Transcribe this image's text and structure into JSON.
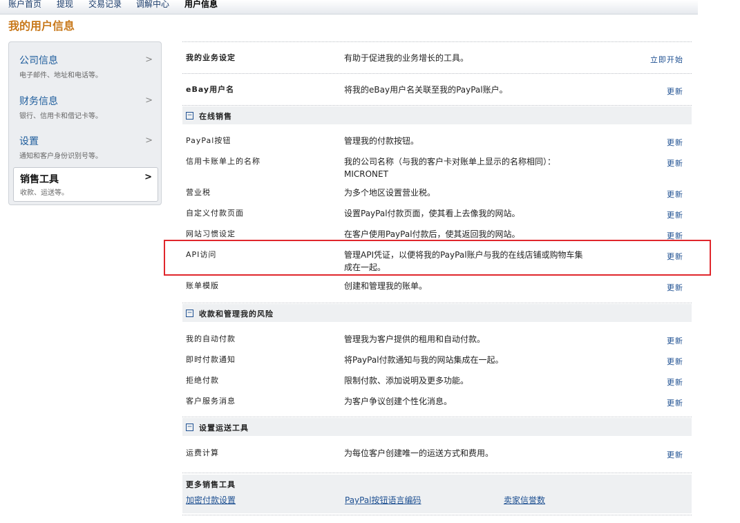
{
  "topnav": {
    "items": [
      "账户首页",
      "提现",
      "交易记录",
      "调解中心",
      "用户信息"
    ]
  },
  "page": {
    "title": "我的用户信息"
  },
  "sidebar": {
    "items": [
      {
        "label": "公司信息",
        "sub": "电子邮件、地址和电话等。",
        "chevron": ">"
      },
      {
        "label": "财务信息",
        "sub": "银行、信用卡和借记卡等。",
        "chevron": ">"
      },
      {
        "label": "设置",
        "sub": "通知和客户身份识别号等。",
        "chevron": ">"
      },
      {
        "label": "销售工具",
        "sub": "收款、运送等。",
        "chevron": ">"
      }
    ]
  },
  "main": {
    "business": {
      "name": "我的业务设定",
      "desc": "有助于促进我的业务增长的工具。",
      "action": "立即开始"
    },
    "ebay": {
      "name": "eBay用户名",
      "desc": "将我的eBay用户名关联至我的PayPal账户。",
      "action": "更新"
    },
    "sections": [
      {
        "toggle": "−",
        "title": "在线销售",
        "rows": [
          {
            "name": "PayPal按钮",
            "desc": "管理我的付款按钮。",
            "action": "更新"
          },
          {
            "name": "信用卡账单上的名称",
            "desc": "我的公司名称（与我的客户卡对账单上显示的名称相同）：MICRONET",
            "action": "更新"
          },
          {
            "name": "营业税",
            "desc": "为多个地区设置营业税。",
            "action": "更新"
          },
          {
            "name": "自定义付款页面",
            "desc": "设置PayPal付款页面，使其看上去像我的网站。",
            "action": "更新"
          },
          {
            "name": "网站习惯设定",
            "desc": "在客户使用PayPal付款后，使其返回我的网站。",
            "action": "更新"
          },
          {
            "name": "API访问",
            "desc": "管理API凭证，以便将我的PayPal账户与我的在线店铺或购物车集成在一起。",
            "action": "更新"
          },
          {
            "name": "账单模版",
            "desc": "创建和管理我的账单。",
            "action": "更新"
          }
        ]
      },
      {
        "toggle": "−",
        "title": "收款和管理我的风险",
        "rows": [
          {
            "name": "我的自动付款",
            "desc": "管理我为客户提供的租用和自动付款。",
            "action": "更新"
          },
          {
            "name": "即时付款通知",
            "desc": "将PayPal付款通知与我的网站集成在一起。",
            "action": "更新"
          },
          {
            "name": "拒绝付款",
            "desc": "限制付款、添加说明及更多功能。",
            "action": "更新"
          },
          {
            "name": "客户服务消息",
            "desc": "为客户争议创建个性化消息。",
            "action": "更新"
          }
        ]
      },
      {
        "toggle": "−",
        "title": "设置运送工具",
        "rows": [
          {
            "name": "运费计算",
            "desc": "为每位客户创建唯一的运送方式和费用。",
            "action": "更新"
          }
        ]
      }
    ],
    "more": {
      "title": "更多销售工具",
      "links": [
        "加密付款设置",
        "PayPal按钮语言编码",
        "卖家信誉数"
      ]
    }
  },
  "colors": {
    "title_orange": "#c8781a",
    "link_blue": "#1d4f91",
    "highlight_red": "#e0262b"
  }
}
